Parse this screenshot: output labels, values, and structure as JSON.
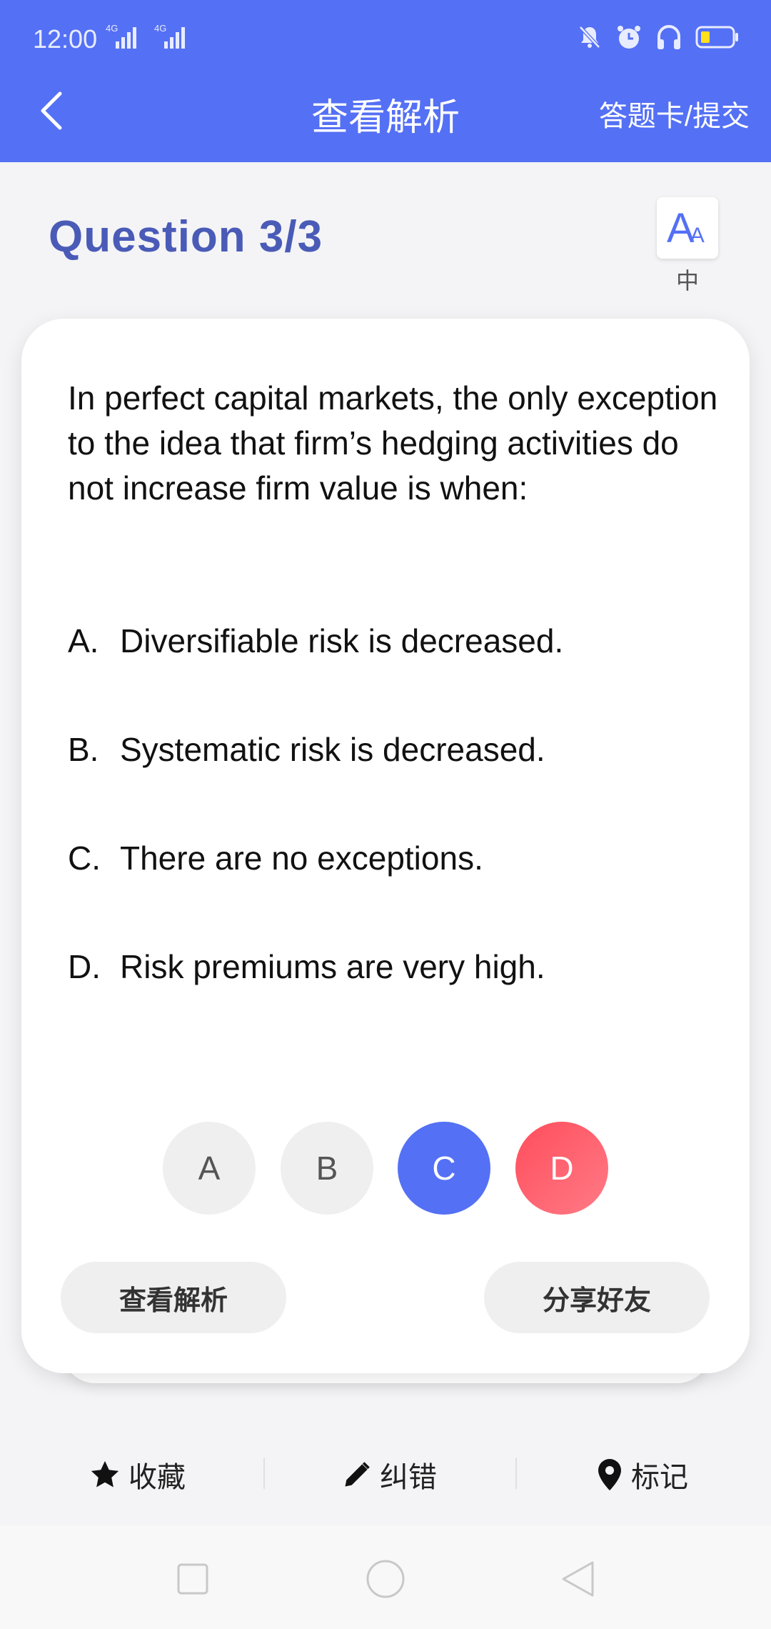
{
  "status_bar": {
    "time": "12:00",
    "network_1": "4G",
    "network_2": "4G",
    "icons": [
      "mute-bell-icon",
      "alarm-icon",
      "headphones-icon",
      "battery-icon"
    ]
  },
  "nav": {
    "back_icon": "chevron-left-icon",
    "title": "查看解析",
    "right_action": "答题卡/提交"
  },
  "question_header": {
    "title": "Question",
    "progress": "3/3",
    "font_button_glyph": "A",
    "font_button_glyph_small": "A",
    "font_size_label": "中"
  },
  "question": {
    "text": "In perfect capital markets, the only exception to the idea that firm’s hedging activities do not increase firm value is when:",
    "options": [
      {
        "letter": "A.",
        "text": "Diversifiable risk is decreased."
      },
      {
        "letter": "B.",
        "text": "Systematic risk is decreased."
      },
      {
        "letter": "C.",
        "text": "There are no exceptions."
      },
      {
        "letter": "D.",
        "text": "Risk premiums are very high."
      }
    ]
  },
  "answer_choices": [
    {
      "label": "A",
      "state": "neutral"
    },
    {
      "label": "B",
      "state": "neutral"
    },
    {
      "label": "C",
      "state": "correct"
    },
    {
      "label": "D",
      "state": "wrong"
    }
  ],
  "actions": {
    "view_analysis": "查看解析",
    "share_friends": "分享好友"
  },
  "bottom_toolbar": [
    {
      "icon": "star-icon",
      "label": "收藏"
    },
    {
      "icon": "pencil-icon",
      "label": "纠错"
    },
    {
      "icon": "location-pin-icon",
      "label": "标记"
    }
  ],
  "colors": {
    "primary": "#5470f5",
    "title": "#4a5bb7",
    "wrong": "#ff5a67",
    "neutral": "#efefef"
  }
}
